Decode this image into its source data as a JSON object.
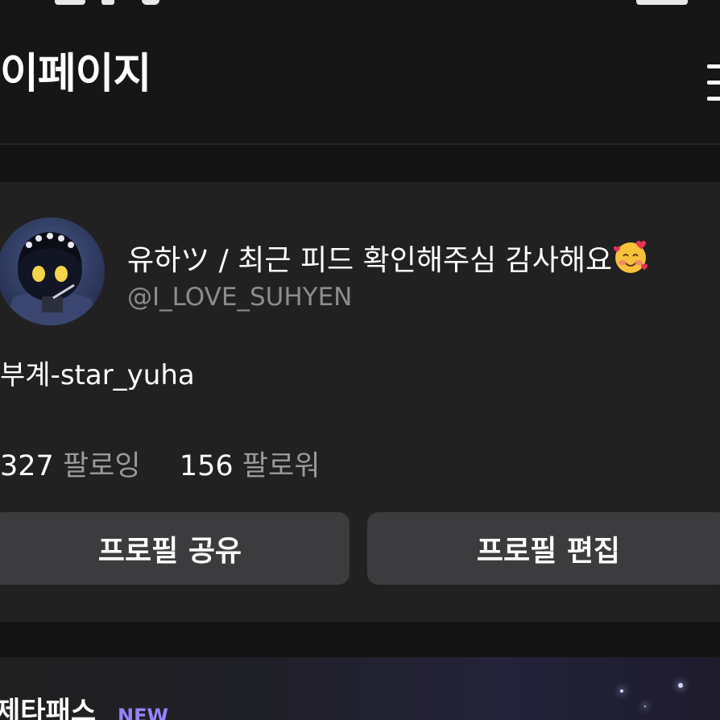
{
  "header": {
    "title": "이페이지",
    "menu_icon": "hamburger-menu-icon"
  },
  "profile": {
    "display_name": "유하ツ / 최근 피드 확인해주심 감사해요",
    "display_name_emoji": "smiling-face-with-hearts-icon",
    "handle": "@I_LOVE_SUHYEN",
    "bio": "부계-star_yuha",
    "following_count": "327",
    "following_label": "팔로잉",
    "followers_count": "156",
    "followers_label": "팔로워"
  },
  "buttons": {
    "share_label": "프로필 공유",
    "edit_label": "프로필 편집"
  },
  "pass_section": {
    "title": "제타패스",
    "badge": "NEW"
  },
  "colors": {
    "background": "#141414",
    "card": "#212121",
    "button": "#3c3c3e",
    "muted_text": "#8c8c8c",
    "badge": "#9a82ff"
  }
}
